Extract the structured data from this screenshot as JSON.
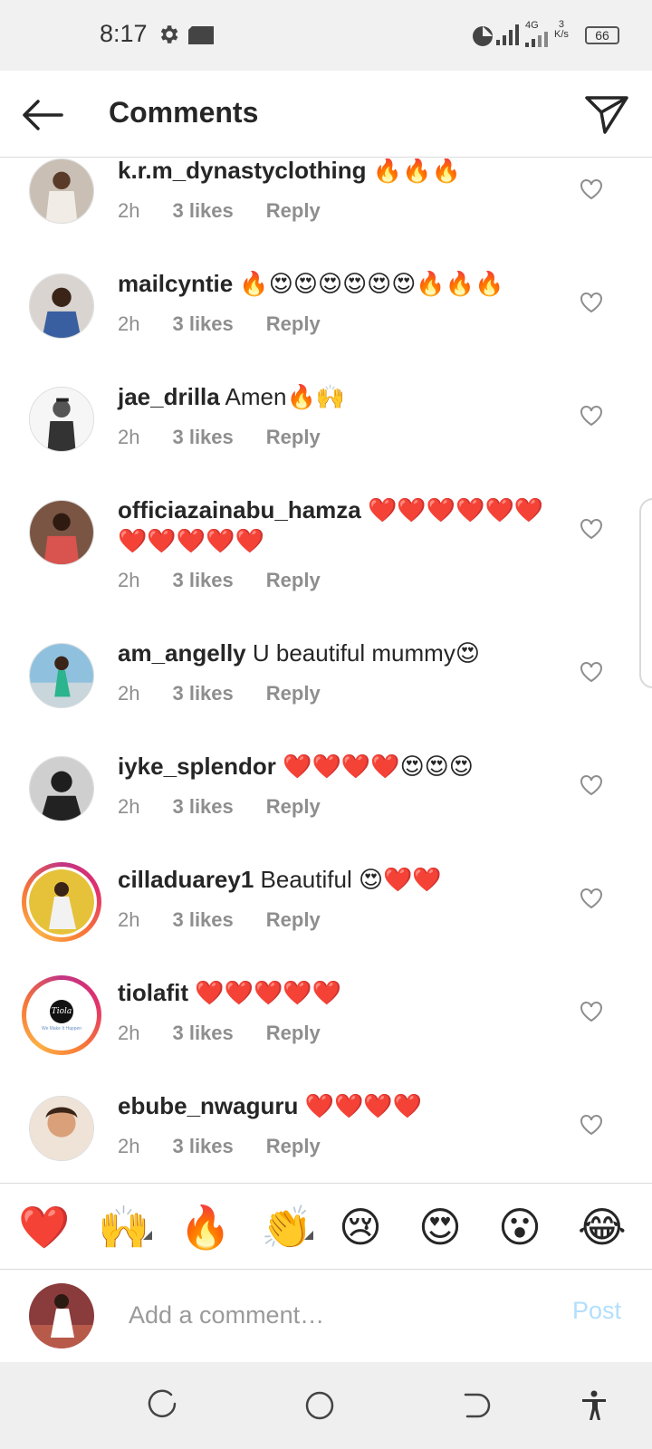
{
  "status_bar": {
    "time": "8:17",
    "network_type": "4G",
    "net_speed": "3",
    "net_speed_unit": "K/s",
    "battery": "66"
  },
  "header": {
    "title": "Comments"
  },
  "comments": [
    {
      "username": "k.r.m_dynastyclothing",
      "text": " 🔥🔥🔥",
      "time": "2h",
      "likes": "3 likes",
      "reply": "Reply",
      "avatar_color": "#b8a89a"
    },
    {
      "username": "mailcyntie",
      "text": " 🔥😍😍😍😍😍😍🔥🔥🔥",
      "time": "2h",
      "likes": "3 likes",
      "reply": "Reply",
      "avatar_color": "#3a5fa0"
    },
    {
      "username": "jae_drilla",
      "text": " Amen🔥🙌",
      "time": "2h",
      "likes": "3 likes",
      "reply": "Reply",
      "avatar_color": "#f4f4f4"
    },
    {
      "username": "officiazainabu_hamza",
      "text": " ❤️❤️❤️❤️❤️❤️❤️❤️❤️❤️❤️",
      "time": "2h",
      "likes": "3 likes",
      "reply": "Reply",
      "avatar_color": "#a0584a"
    },
    {
      "username": "am_angelly",
      "text": " U beautiful mummy😍",
      "time": "2h",
      "likes": "3 likes",
      "reply": "Reply",
      "avatar_color": "#6fa6c9"
    },
    {
      "username": "iyke_splendor",
      "text": " ❤️❤️❤️❤️😍😍😍",
      "time": "2h",
      "likes": "3 likes",
      "reply": "Reply",
      "avatar_color": "#2b2b2b"
    },
    {
      "username": "cilladuarey1",
      "text": " Beautiful 😍❤️❤️",
      "time": "2h",
      "likes": "3 likes",
      "reply": "Reply",
      "avatar_color": "#e5c23a"
    },
    {
      "username": "tiolafit",
      "text": " ❤️❤️❤️❤️❤️",
      "time": "2h",
      "likes": "3 likes",
      "reply": "Reply",
      "avatar_color": "#ffffff",
      "avatar_text": "Tiola",
      "avatar_subtext": "We Make It Happen"
    },
    {
      "username": "ebube_nwaguru",
      "text": " ❤️❤️❤️❤️",
      "time": "2h",
      "likes": "3 likes",
      "reply": "Reply",
      "avatar_color": "#d9a07a"
    }
  ],
  "reactions": [
    "❤️",
    "🙌",
    "🔥",
    "👏",
    "😢",
    "😍",
    "😮",
    "😂"
  ],
  "composer": {
    "placeholder": "Add a comment…",
    "post_label": "Post"
  },
  "colors": {
    "accent_disabled": "#b2dffc",
    "secondary_text": "#8e8e8e"
  }
}
